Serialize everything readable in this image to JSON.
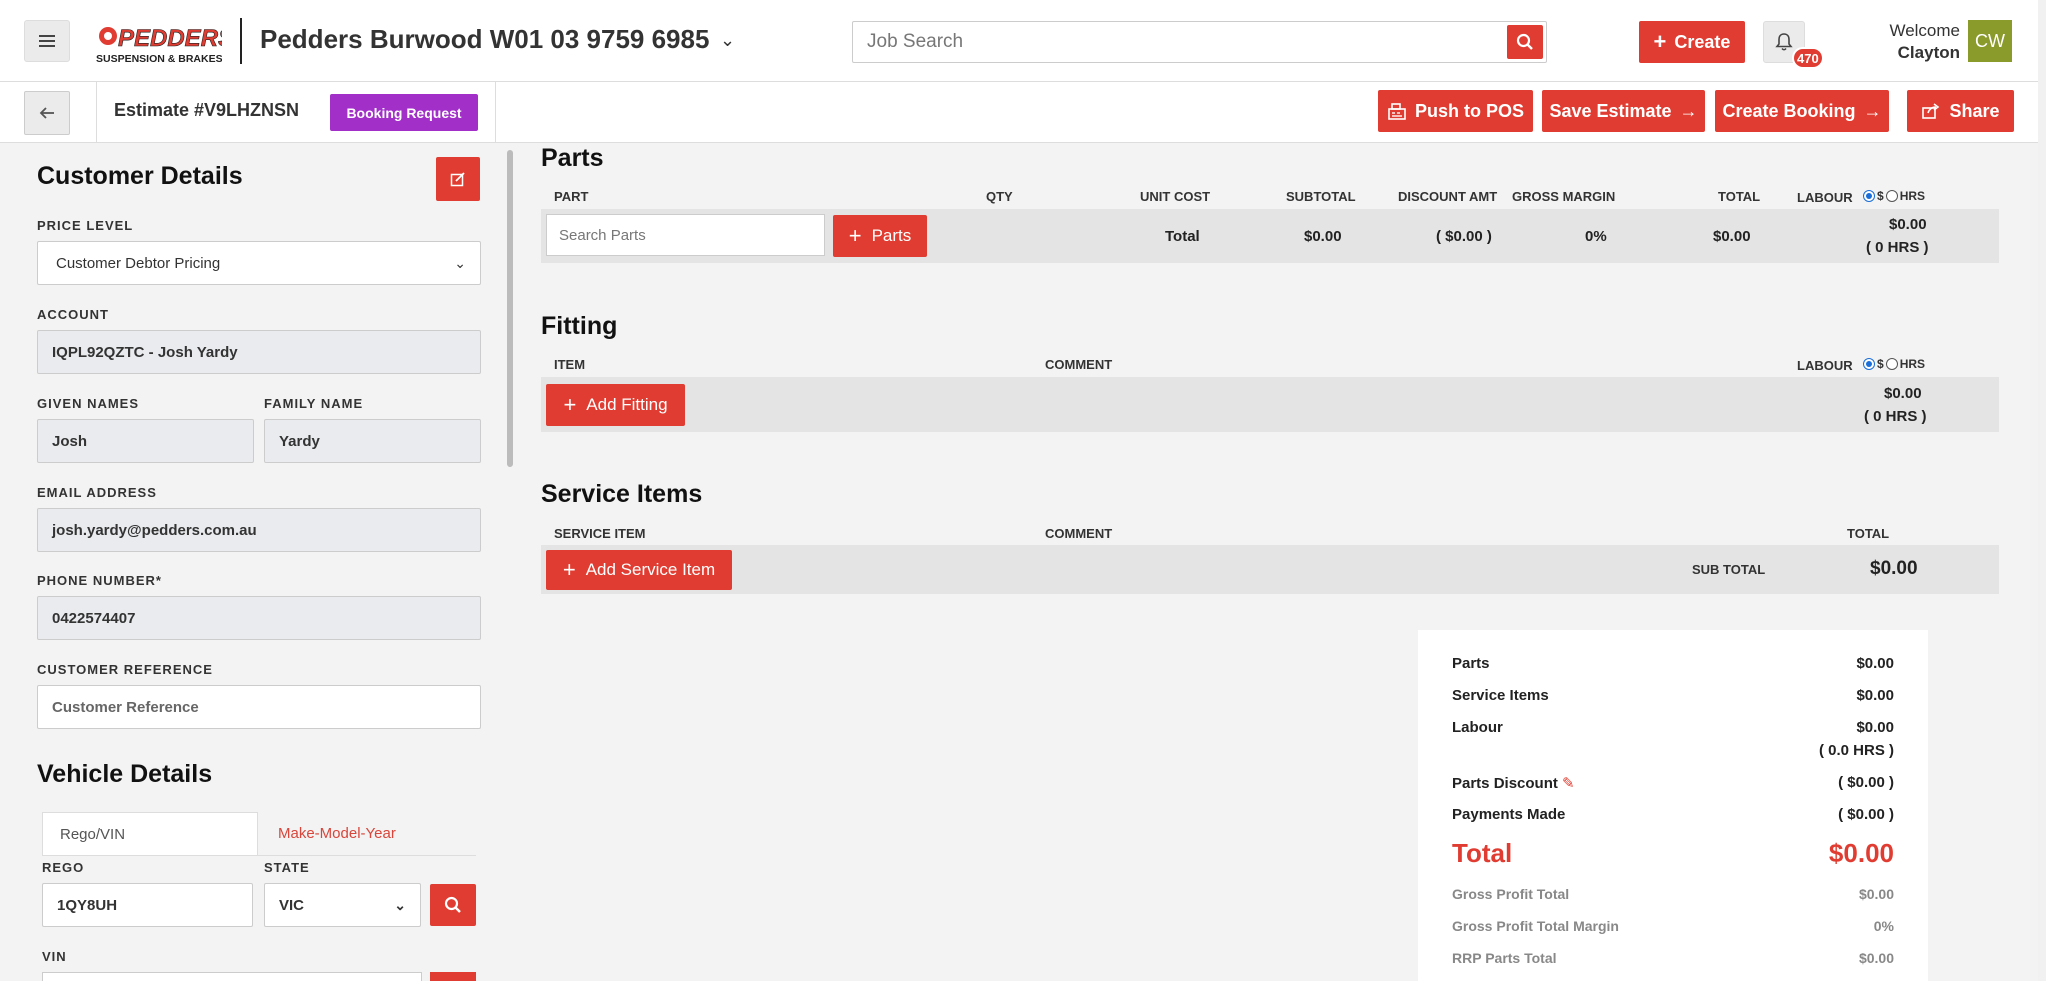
{
  "header": {
    "logo_text": "PEDDERS",
    "logo_subtext": "SUSPENSION & BRAKES",
    "store_name": "Pedders Burwood W01 03 9759 6985",
    "search_placeholder": "Job Search",
    "create_label": "Create",
    "notification_count": "470",
    "welcome_text": "Welcome",
    "user_name": "Clayton",
    "avatar_initials": "CW"
  },
  "subheader": {
    "estimate_title": "Estimate #V9LHZNSN",
    "booking_request_label": "Booking Request",
    "push_pos_label": "Push to POS",
    "save_estimate_label": "Save Estimate",
    "create_booking_label": "Create Booking",
    "share_label": "Share"
  },
  "customer": {
    "section_title": "Customer Details",
    "price_level_label": "PRICE LEVEL",
    "price_level_value": "Customer Debtor Pricing",
    "account_label": "ACCOUNT",
    "account_value": "IQPL92QZTC - Josh Yardy",
    "given_names_label": "GIVEN NAMES",
    "given_names_value": "Josh",
    "family_name_label": "FAMILY NAME",
    "family_name_value": "Yardy",
    "email_label": "EMAIL ADDRESS",
    "email_value": "josh.yardy@pedders.com.au",
    "phone_label": "PHONE NUMBER*",
    "phone_value": "0422574407",
    "reference_label": "CUSTOMER REFERENCE",
    "reference_placeholder": "Customer Reference"
  },
  "vehicle": {
    "section_title": "Vehicle Details",
    "tab_rego": "Rego/VIN",
    "tab_mmy": "Make-Model-Year",
    "rego_label": "REGO",
    "rego_value": "1QY8UH",
    "state_label": "STATE",
    "state_value": "VIC",
    "vin_label": "VIN"
  },
  "parts": {
    "title": "Parts",
    "columns": [
      "PART",
      "QTY",
      "UNIT COST",
      "SUBTOTAL",
      "DISCOUNT AMT",
      "GROSS MARGIN",
      "TOTAL",
      "LABOUR"
    ],
    "search_placeholder": "Search Parts",
    "add_label": "Parts",
    "total_label": "Total",
    "subtotal": "$0.00",
    "discount": "( $0.00 )",
    "gross_margin": "0%",
    "total": "$0.00",
    "labour_amount": "$0.00",
    "labour_hours": "( 0 HRS )",
    "toggle_dollar": "$",
    "toggle_hrs": "HRS"
  },
  "fitting": {
    "title": "Fitting",
    "columns": [
      "ITEM",
      "COMMENT",
      "LABOUR"
    ],
    "add_label": "Add Fitting",
    "labour_amount": "$0.00",
    "labour_hours": "( 0 HRS )",
    "toggle_dollar": "$",
    "toggle_hrs": "HRS"
  },
  "service": {
    "title": "Service Items",
    "columns": [
      "SERVICE ITEM",
      "COMMENT",
      "TOTAL"
    ],
    "add_label": "Add Service Item",
    "subtotal_label": "SUB TOTAL",
    "subtotal_value": "$0.00"
  },
  "summary": {
    "parts_label": "Parts",
    "parts_value": "$0.00",
    "service_label": "Service Items",
    "service_value": "$0.00",
    "labour_label": "Labour",
    "labour_value": "$0.00",
    "labour_hours": "( 0.0 HRS )",
    "discount_label": "Parts Discount",
    "discount_value": "( $0.00 )",
    "payments_label": "Payments Made",
    "payments_value": "( $0.00 )",
    "total_label": "Total",
    "total_value": "$0.00",
    "gp_total_label": "Gross Profit Total",
    "gp_total_value": "$0.00",
    "gp_margin_label": "Gross Profit Total Margin",
    "gp_margin_value": "0%",
    "rrp_label": "RRP Parts Total",
    "rrp_value": "$0.00"
  },
  "colors": {
    "accent_red": "#e03c31",
    "booking_purple": "#a12fc8",
    "avatar_green": "#8a9a2b"
  }
}
